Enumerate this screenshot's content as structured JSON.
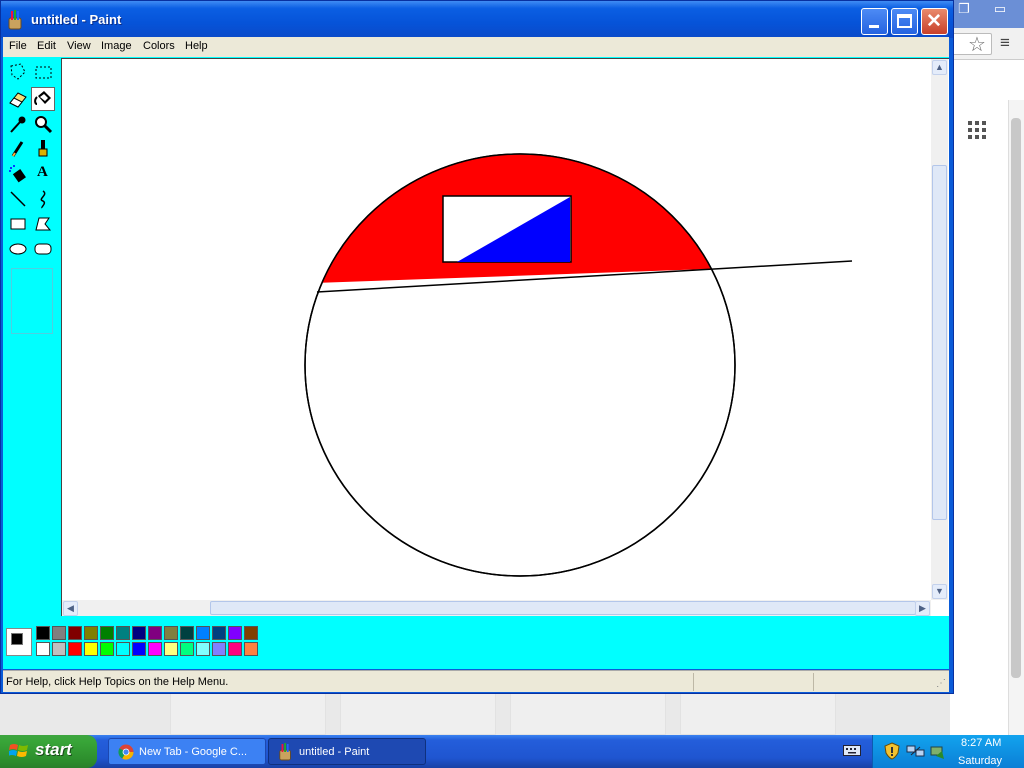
{
  "window": {
    "title": "untitled - Paint",
    "minimize_icon": "minimize-icon",
    "maximize_icon": "maximize-icon",
    "close_icon": "close-icon"
  },
  "menubar": {
    "items": [
      "File",
      "Edit",
      "View",
      "Image",
      "Colors",
      "Help"
    ]
  },
  "toolbox": {
    "tools": [
      "free-form-select-icon",
      "select-icon",
      "eraser-icon",
      "fill-with-color-icon",
      "pick-color-icon",
      "magnifier-icon",
      "pencil-icon",
      "brush-icon",
      "airbrush-icon",
      "text-icon",
      "line-icon",
      "curve-icon",
      "rectangle-icon",
      "polygon-icon",
      "ellipse-icon",
      "rounded-rectangle-icon"
    ],
    "active_tool": "fill-with-color-icon"
  },
  "palette": {
    "foreground": "#000000",
    "background": "#ffffff",
    "top_row": [
      "#000000",
      "#808080",
      "#800000",
      "#808000",
      "#008000",
      "#008080",
      "#000080",
      "#800080",
      "#808040",
      "#004040",
      "#0080ff",
      "#004080",
      "#8000ff",
      "#804000"
    ],
    "bottom_row": [
      "#ffffff",
      "#c0c0c0",
      "#ff0000",
      "#ffff00",
      "#00ff00",
      "#00ffff",
      "#0000ff",
      "#ff00ff",
      "#ffff80",
      "#00ff80",
      "#80ffff",
      "#8080ff",
      "#ff0080",
      "#ff8040"
    ]
  },
  "colors": {
    "workspace": "#00ffff",
    "fill_red": "#ff0000",
    "fill_blue": "#0000ff"
  },
  "statusbar": {
    "text": "For Help, click Help Topics on the Help Menu."
  },
  "taskbar": {
    "start_label": "start",
    "tasks": [
      {
        "label": "New Tab - Google C...",
        "icon": "chrome-icon"
      },
      {
        "label": "untitled - Paint",
        "icon": "paint-icon"
      }
    ],
    "clock_time": "8:27 AM",
    "clock_day": "Saturday"
  },
  "background_window": {
    "icons": [
      "restore-icon",
      "minimize-icon",
      "star-icon",
      "menu-icon",
      "apps-grid-icon"
    ]
  }
}
